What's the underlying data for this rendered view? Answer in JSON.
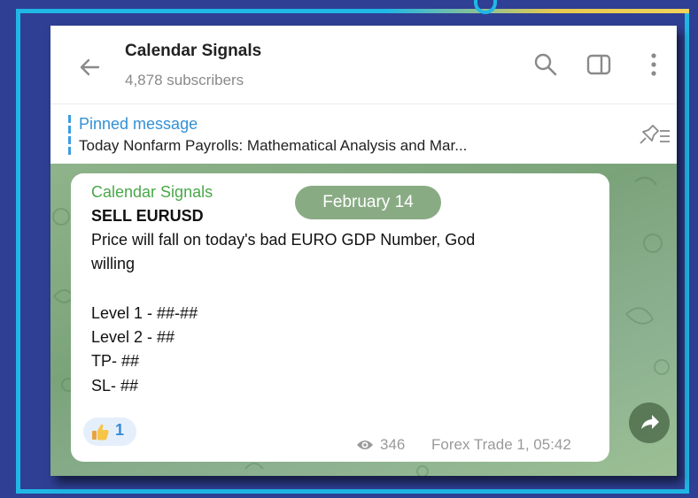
{
  "colors": {
    "background": "#2f3f93",
    "frame": "#1fb7e6",
    "accent_link": "#3390d6",
    "author": "#4aa84a",
    "chat_bg": "#8fb38a"
  },
  "header": {
    "title": "Calendar Signals",
    "subtitle": "4,878 subscribers",
    "icons": [
      "back-arrow-icon",
      "search-icon",
      "sidebar-icon",
      "more-vertical-icon"
    ]
  },
  "pinned": {
    "title": "Pinned message",
    "text": "Today Nonfarm Payrolls: Mathematical Analysis and Mar...",
    "icon": "pin-list-icon"
  },
  "date_pill": "February 14",
  "message": {
    "author": "Calendar Signals",
    "headline": "SELL EURUSD",
    "line1": "Price will fall on today's bad EURO GDP Number, God",
    "line2": "willing",
    "level1": "Level 1 - ##-##",
    "level2": "Level 2 - ##",
    "tp": "TP- ##",
    "sl": "SL- ##",
    "reaction": {
      "emoji": "thumbs-up",
      "count": "1"
    },
    "views": "346",
    "signature": "Forex Trade 1, 05:42"
  },
  "forward_icon": "forward-arrow-icon"
}
